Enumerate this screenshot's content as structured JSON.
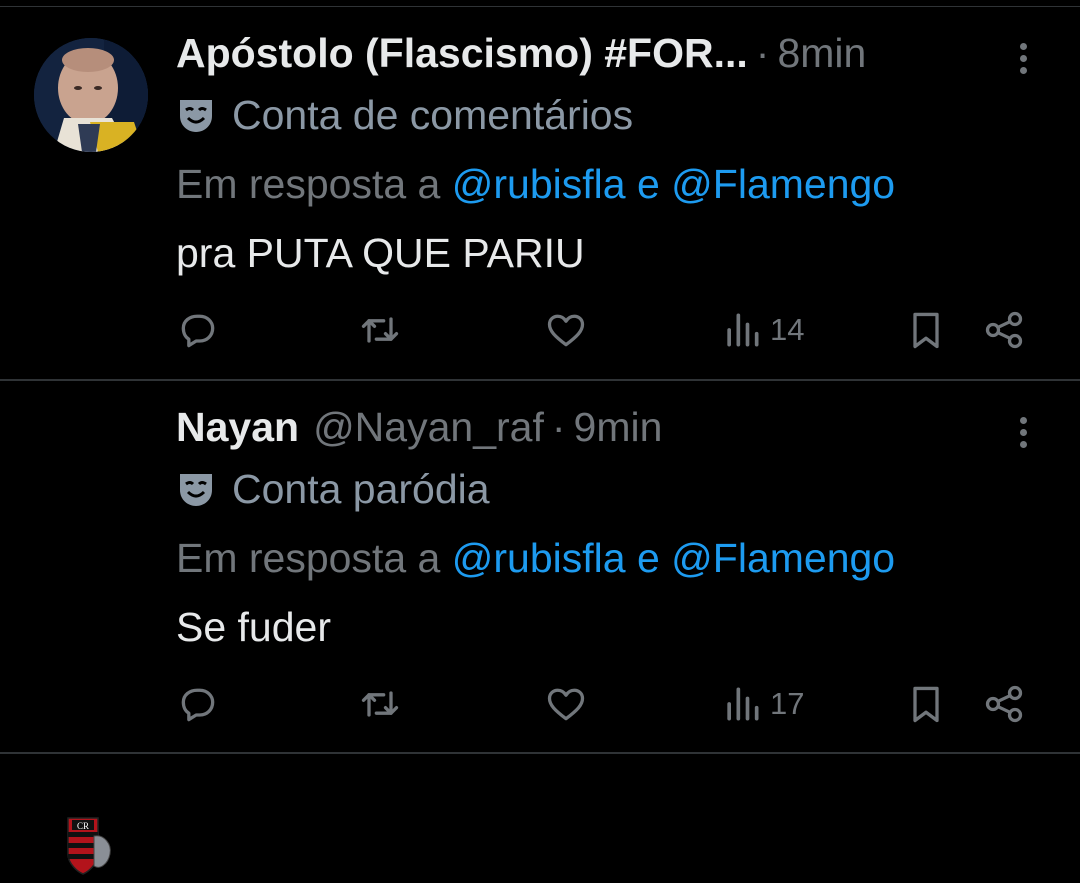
{
  "tweets": [
    {
      "name": "Apóstolo (Flascismo) #FOR...",
      "handle": "",
      "dot": "·",
      "time": "8min",
      "label": "Conta de comentários",
      "reply_prefix": "Em resposta a",
      "reply_mention1": "@rubisfla",
      "reply_and": "e",
      "reply_mention2": "@Flamengo",
      "text": "pra PUTA QUE PARIU",
      "views": "14"
    },
    {
      "name": "Nayan",
      "handle": "@Nayan_raf",
      "dot": "·",
      "time": "9min",
      "label": "Conta paródia",
      "reply_prefix": "Em resposta a",
      "reply_mention1": "@rubisfla",
      "reply_and": "e",
      "reply_mention2": "@Flamengo",
      "text": "Se fuder",
      "views": "17"
    }
  ],
  "icons": {
    "reply": "reply-bubble-icon",
    "retweet": "retweet-icon",
    "like": "heart-icon",
    "views": "bar-chart-icon",
    "bookmark": "bookmark-icon",
    "share": "share-icon",
    "more": "more-dots-icon",
    "label": "theater-mask-icon"
  },
  "colors": {
    "background": "#000000",
    "text": "#e7e9ea",
    "muted": "#71767b",
    "link": "#1d9bf0",
    "divider": "#2f3336"
  }
}
